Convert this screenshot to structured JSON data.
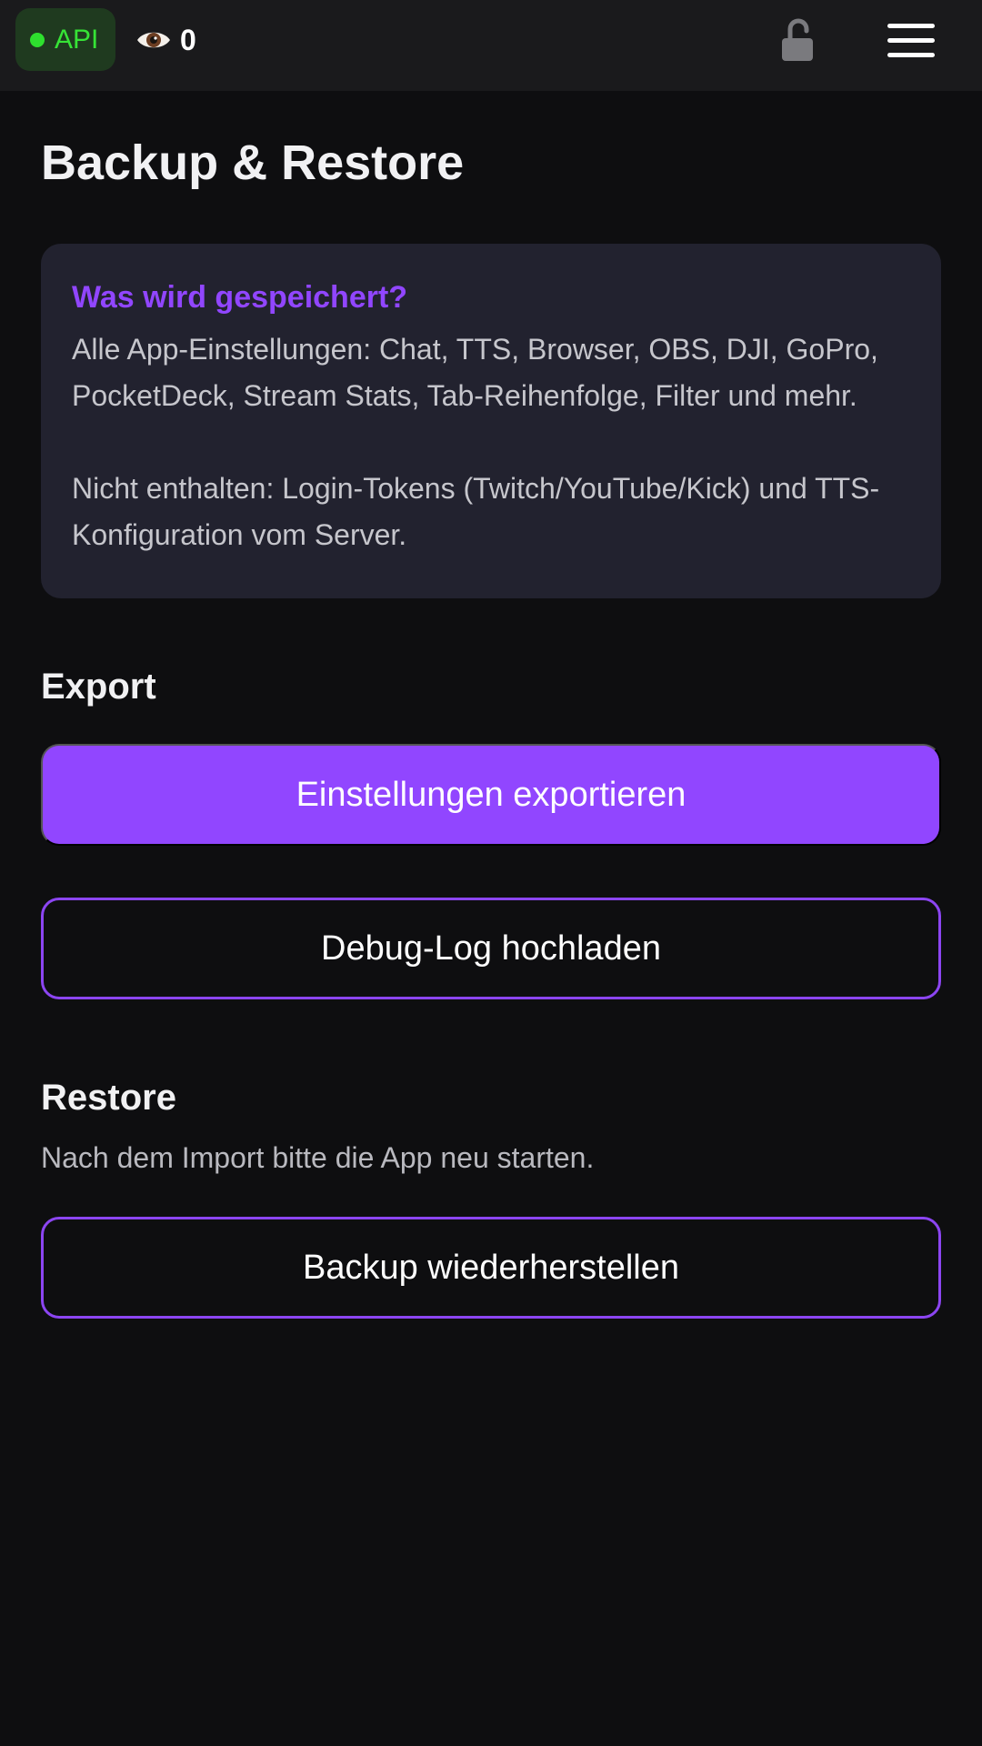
{
  "topbar": {
    "api_label": "API",
    "api_status_color": "#2ee02e",
    "viewer_icon": "eye-icon",
    "viewer_count": "0",
    "lock_icon": "unlocked-padlock-icon",
    "menu_icon": "hamburger-menu-icon"
  },
  "page": {
    "title": "Backup & Restore"
  },
  "info_card": {
    "title": "Was wird gespeichert?",
    "included_text": "Alle App-Einstellungen: Chat, TTS, Browser, OBS, DJI, GoPro, PocketDeck, Stream Stats, Tab-Reihenfolge, Filter und mehr.",
    "excluded_text": "Nicht enthalten: Login-Tokens (Twitch/YouTube/Kick) und TTS-Konfiguration vom Server."
  },
  "export": {
    "heading": "Export",
    "export_button": "Einstellungen exportieren",
    "debug_button": "Debug-Log hochladen"
  },
  "restore": {
    "heading": "Restore",
    "hint": "Nach dem Import bitte die App neu starten.",
    "restore_button": "Backup wiederherstellen"
  },
  "colors": {
    "accent": "#9146ff",
    "background": "#0e0e10",
    "card": "#22222f"
  }
}
